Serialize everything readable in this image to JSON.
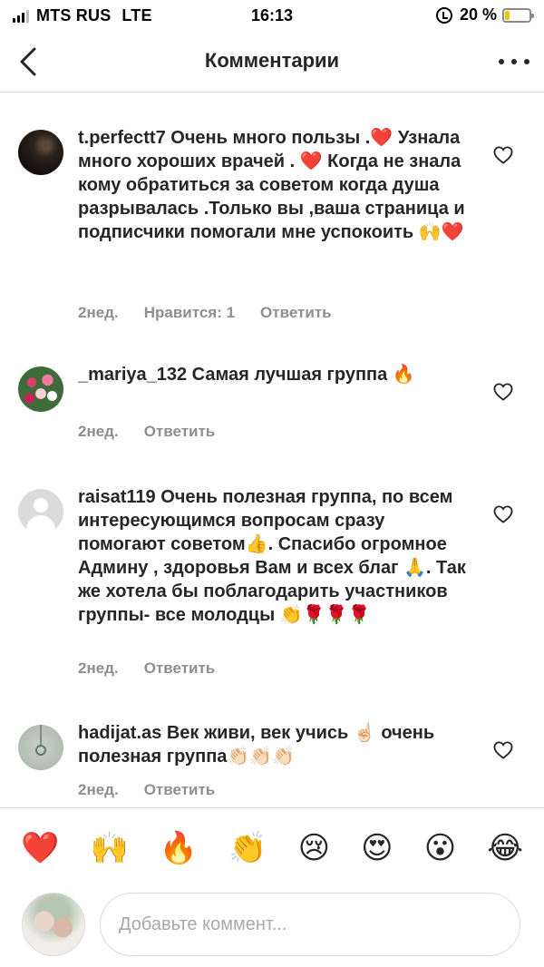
{
  "status_bar": {
    "carrier": "MTS RUS",
    "network": "LTE",
    "time": "16:13",
    "battery_percent": "20 %",
    "battery_level": 0.2
  },
  "nav": {
    "title": "Комментарии",
    "back_icon": "chevron-left-icon",
    "more_icon": "more-horizontal-icon"
  },
  "comments": [
    {
      "username": "t.perfectt7",
      "text": "Очень много пользы .❤️ Узнала много хороших врачей . ❤️ Когда не знала кому обратиться за советом когда душа разрывалась .Только вы ,ваша страница и подписчики помогали мне успокоить 🙌❤️",
      "time": "2нед.",
      "likes": "Нравится: 1",
      "reply": "Ответить"
    },
    {
      "username": "_mariya_132",
      "text": "Самая лучшая группа 🔥",
      "time": "2нед.",
      "reply": "Ответить"
    },
    {
      "username": "raisat119",
      "text": "Очень полезная группа, по всем интересующимся вопросам сразу помогают советом👍. Спасибо огромное Админу , здоровья Вам и всех благ 🙏. Так же хотела бы поблагодарить участников группы- все молодцы 👏🌹🌹🌹",
      "time": "2нед.",
      "reply": "Ответить"
    },
    {
      "username": "hadijat.as",
      "text": "Век живи, век учись ☝🏻 очень полезная группа👏🏻👏🏻👏🏻",
      "time": "2нед.",
      "reply": "Ответить"
    }
  ],
  "reactions": [
    "❤️",
    "🙌",
    "🔥",
    "👏",
    "😢",
    "😍",
    "😮",
    "😂"
  ],
  "composer": {
    "placeholder": "Добавьте коммент..."
  },
  "colors": {
    "text": "#262626",
    "secondary": "#8e8e8e",
    "divider": "#dbdbdb",
    "battery": "#f5c400"
  }
}
